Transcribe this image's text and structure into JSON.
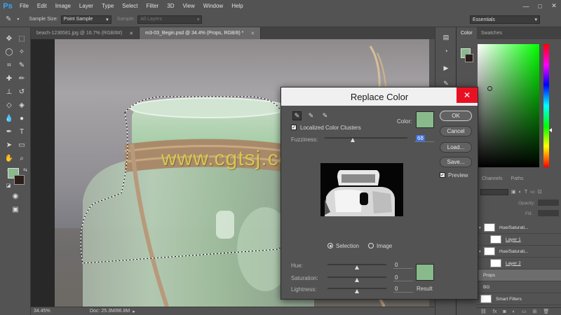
{
  "app": {
    "logo": "Ps"
  },
  "menubar": [
    "File",
    "Edit",
    "Image",
    "Layer",
    "Type",
    "Select",
    "Filter",
    "3D",
    "View",
    "Window",
    "Help"
  ],
  "window_controls": [
    "—",
    "□",
    "✕"
  ],
  "options_bar": {
    "sample_size_label": "Sample Size:",
    "sample_size_value": "Point Sample",
    "sample_label": "Sample:",
    "sample_value": "All Layers",
    "workspace": "Essentials"
  },
  "tabs": [
    {
      "label": "beach-1236581.jpg @ 16.7% (RGB/8#)",
      "active": false
    },
    {
      "label": "m3-03_Begin.psd @ 34.4% (Props, RGB/8) *",
      "active": true
    }
  ],
  "status": {
    "zoom": "34.45%",
    "doc": "Doc: 25.3M/86.8M"
  },
  "color_panel": {
    "tabs": [
      "Color",
      "Swatches"
    ],
    "fg_color": "#88ba8c",
    "bg_color": "#2b1d18"
  },
  "layers_panel": {
    "tabs": [
      "Channels",
      "Paths"
    ],
    "opacity_label": "Opacity:",
    "fill_label": "Fill:",
    "layers": [
      {
        "name": "Hue/Saturati...",
        "underline": false,
        "selected": false
      },
      {
        "name": "Layer 1",
        "underline": true,
        "selected": false
      },
      {
        "name": "Hue/Saturati...",
        "underline": false,
        "selected": false
      },
      {
        "name": "Layer 2",
        "underline": true,
        "selected": false
      },
      {
        "name": "Props",
        "underline": false,
        "selected": true
      },
      {
        "name": "BG",
        "underline": false,
        "selected": false
      },
      {
        "name": "Smart Filters",
        "underline": false,
        "selected": false
      }
    ]
  },
  "watermark": "www.cgtsj.com",
  "dialog": {
    "title": "Replace Color",
    "close": "✕",
    "color_label": "Color:",
    "selection_color": "#88ba8c",
    "localized_label": "Localized Color Clusters",
    "localized_checked": true,
    "fuzziness_label": "Fuzziness:",
    "fuzziness_value": "68",
    "fuzziness": 68,
    "fuzziness_max": 200,
    "buttons": {
      "ok": "OK",
      "cancel": "Cancel",
      "load": "Load...",
      "save": "Save..."
    },
    "preview_label": "Preview",
    "preview_checked": true,
    "selection_radio": "Selection",
    "image_radio": "Image",
    "hue_label": "Hue:",
    "hue_value": "0",
    "saturation_label": "Saturation:",
    "saturation_value": "0",
    "lightness_label": "Lightness:",
    "lightness_value": "0",
    "result_label": "Result",
    "result_color": "#88ba8c"
  }
}
